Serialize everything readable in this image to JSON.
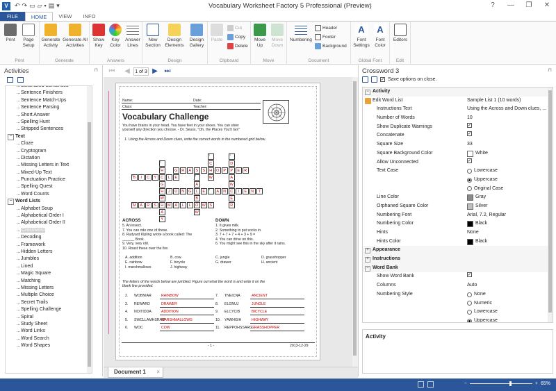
{
  "app": {
    "title": "Vocabulary Worksheet Factory 5 Professional (Preview)",
    "icon": "V",
    "window_controls": [
      "?",
      "—",
      "❐",
      "✕"
    ]
  },
  "tabs": [
    "FILE",
    "HOME",
    "VIEW",
    "INFO"
  ],
  "ribbon": {
    "groups": [
      {
        "label": "Print",
        "buttons": [
          "Print",
          "Page Setup"
        ]
      },
      {
        "label": "Generate",
        "buttons": [
          "Generate Activity",
          "Generate All Activities"
        ]
      },
      {
        "label": "Answers",
        "buttons": [
          "Show Key",
          "Key Color",
          "Answer Lines"
        ]
      },
      {
        "label": "Design",
        "buttons": [
          "New Section",
          "Design Elements",
          "Design Gallery"
        ]
      },
      {
        "label": "Clipboard",
        "buttons": [
          "Paste",
          "Cut",
          "Copy",
          "Delete"
        ]
      },
      {
        "label": "Move",
        "buttons": [
          "Move Up",
          "Move Down"
        ]
      },
      {
        "label": "Document",
        "buttons": [
          "Numbering",
          "Header",
          "Footer",
          "Background"
        ]
      },
      {
        "label": "Global Font",
        "buttons": [
          "Font Settings",
          "Font Color"
        ]
      },
      {
        "label": "Edit",
        "buttons": [
          "Editors"
        ]
      }
    ]
  },
  "activities": {
    "title": "Activities",
    "items": [
      {
        "kind": "item",
        "label": "Scrambled Sentences"
      },
      {
        "kind": "item",
        "label": "Sentence Finishers"
      },
      {
        "kind": "item",
        "label": "Sentence Match-Ups"
      },
      {
        "kind": "item",
        "label": "Sentence Parsing"
      },
      {
        "kind": "item",
        "label": "Short Answer"
      },
      {
        "kind": "item",
        "label": "Spelling Hunt"
      },
      {
        "kind": "item",
        "label": "Stripped Sentences"
      },
      {
        "kind": "cat",
        "label": "Text"
      },
      {
        "kind": "item",
        "label": "Cloze"
      },
      {
        "kind": "item",
        "label": "Cryptogram"
      },
      {
        "kind": "item",
        "label": "Dictation"
      },
      {
        "kind": "item",
        "label": "Missing Letters in Text"
      },
      {
        "kind": "item",
        "label": "Mixed-Up Text"
      },
      {
        "kind": "item",
        "label": "Punctuation Practice"
      },
      {
        "kind": "item",
        "label": "Spelling Quest"
      },
      {
        "kind": "item",
        "label": "Word Counts"
      },
      {
        "kind": "cat",
        "label": "Word Lists"
      },
      {
        "kind": "item",
        "label": "Alphabet Soup"
      },
      {
        "kind": "item",
        "label": "Alphabetical Order I"
      },
      {
        "kind": "item",
        "label": "Alphabetical Order II"
      },
      {
        "kind": "item",
        "label": "Crossword",
        "selected": true
      },
      {
        "kind": "item",
        "label": "Decoding"
      },
      {
        "kind": "item",
        "label": "Framework"
      },
      {
        "kind": "item",
        "label": "Hidden Letters"
      },
      {
        "kind": "item",
        "label": "Jumbles"
      },
      {
        "kind": "item",
        "label": "Lined"
      },
      {
        "kind": "item",
        "label": "Magic Square"
      },
      {
        "kind": "item",
        "label": "Matching"
      },
      {
        "kind": "item",
        "label": "Missing Letters"
      },
      {
        "kind": "item",
        "label": "Multiple Choice"
      },
      {
        "kind": "item",
        "label": "Secret Trails"
      },
      {
        "kind": "item",
        "label": "Spelling Challenge"
      },
      {
        "kind": "item",
        "label": "Spiral"
      },
      {
        "kind": "item",
        "label": "Study Sheet"
      },
      {
        "kind": "item",
        "label": "Word Links"
      },
      {
        "kind": "item",
        "label": "Word Search"
      },
      {
        "kind": "item",
        "label": "Word Shapes"
      }
    ]
  },
  "nav": {
    "page_indicator": "1 of 3"
  },
  "document_tab": "Document 1",
  "worksheet": {
    "name_label": "Name:",
    "date_label": "Date:",
    "class_label": "Class:",
    "teacher_label": "Teacher:",
    "title": "Vocabulary Challenge",
    "intro1": "You have brains in your head. You have feet in your shoes. You can steer",
    "intro2": "yourself any direction you choose. - Dr. Seuss, \"Oh, the Places You'll Go!\"",
    "instruction1": "1.   Using the Across and Down clues, write the correct words in the numbered grid below.",
    "across_title": "ACROSS",
    "across": [
      "5.  An insect.",
      "7.  You can ride one of these.",
      "8.  Rudyard Kipling wrote a book called: The",
      "     ______ Book.",
      "9.  Very, very old.",
      "10. Roast these over the fire."
    ],
    "down_title": "DOWN",
    "down": [
      "1.  It gives milk.",
      "2.  Something to put socks in.",
      "3.  7 + 7 + 7 + 4 + 3 + 9 =",
      "4.  You can drive on this.",
      "6.  You might see this in the sky after it rains."
    ],
    "choices": [
      [
        "A.  addition",
        "B.  cow",
        "C.  jungle",
        "D.  grasshopper"
      ],
      [
        "E.  rainbow",
        "F.  bicycle",
        "G.  drawer",
        "H.  ancient"
      ],
      [
        "I.   marshmallows",
        "J.  highway",
        "",
        ""
      ]
    ],
    "instruction2a": "The letters of the words below are jumbled. Figure out what the word is and write it on the",
    "instruction2b": "blank line provided.",
    "jumbles_left": [
      {
        "num": "2.",
        "jumble": "WOBNIAR",
        "answer": "RAINBOW"
      },
      {
        "num": "3.",
        "jumble": "REWARD",
        "answer": "DRAWER"
      },
      {
        "num": "4.",
        "jumble": "NOITIDDA",
        "answer": "ADDITION"
      },
      {
        "num": "5.",
        "jumble": "SWCLLAMHSRAM",
        "answer": "MARSHMALLOWS"
      },
      {
        "num": "6.",
        "jumble": "WOC",
        "answer": "COW"
      }
    ],
    "jumbles_right": [
      {
        "num": "7.",
        "jumble": "TNEICNA",
        "answer": "ANCIENT"
      },
      {
        "num": "8.",
        "jumble": "ELGNUJ",
        "answer": "JUNGLE"
      },
      {
        "num": "9.",
        "jumble": "ELCYCIB",
        "answer": "BICYCLE"
      },
      {
        "num": "10.",
        "jumble": "YAWHGIH",
        "answer": "HIGHWAY"
      },
      {
        "num": "11.",
        "jumble": "REPPOHSSARG",
        "answer": "GRASSHOPPER"
      }
    ],
    "footer_page": "- 1 -",
    "footer_date": "2013-12-29"
  },
  "crossword": {
    "cells": [
      [
        1,
        11,
        "",
        "1"
      ],
      [
        1,
        14,
        "",
        "2"
      ],
      [
        2,
        4,
        "",
        "3"
      ],
      [
        2,
        11,
        "C",
        ""
      ],
      [
        2,
        14,
        "D",
        ""
      ],
      [
        3,
        4,
        "H",
        "4"
      ],
      [
        3,
        6,
        "G",
        ""
      ],
      [
        3,
        7,
        "R",
        ""
      ],
      [
        3,
        8,
        "A",
        ""
      ],
      [
        3,
        9,
        "S",
        ""
      ],
      [
        3,
        10,
        "S",
        ""
      ],
      [
        3,
        11,
        "H",
        ""
      ],
      [
        3,
        12,
        "O",
        ""
      ],
      [
        3,
        13,
        "P",
        ""
      ],
      [
        3,
        14,
        "P",
        ""
      ],
      [
        3,
        15,
        "E",
        ""
      ],
      [
        3,
        16,
        "R",
        ""
      ],
      [
        4,
        0,
        "B",
        "5"
      ],
      [
        4,
        1,
        "I",
        ""
      ],
      [
        4,
        2,
        "C",
        ""
      ],
      [
        4,
        3,
        "Y",
        ""
      ],
      [
        4,
        4,
        "C",
        ""
      ],
      [
        4,
        5,
        "L",
        ""
      ],
      [
        4,
        6,
        "E",
        ""
      ],
      [
        4,
        9,
        "",
        "6"
      ],
      [
        4,
        11,
        "W",
        ""
      ],
      [
        4,
        14,
        "A",
        ""
      ],
      [
        5,
        4,
        "G",
        ""
      ],
      [
        5,
        9,
        "A",
        ""
      ],
      [
        5,
        14,
        "W",
        ""
      ],
      [
        6,
        4,
        "H",
        "7"
      ],
      [
        6,
        5,
        "J",
        ""
      ],
      [
        6,
        6,
        "U",
        ""
      ],
      [
        6,
        7,
        "N",
        ""
      ],
      [
        6,
        8,
        "G",
        ""
      ],
      [
        6,
        9,
        "L",
        ""
      ],
      [
        6,
        10,
        "E",
        ""
      ],
      [
        6,
        11,
        "",
        "8"
      ],
      [
        6,
        12,
        "A",
        ""
      ],
      [
        6,
        13,
        "N",
        ""
      ],
      [
        6,
        14,
        "C",
        ""
      ],
      [
        6,
        15,
        "I",
        ""
      ],
      [
        6,
        16,
        "E",
        ""
      ],
      [
        6,
        17,
        "N",
        ""
      ],
      [
        6,
        18,
        "T",
        ""
      ],
      [
        7,
        4,
        "W",
        ""
      ],
      [
        7,
        9,
        "B",
        ""
      ],
      [
        7,
        14,
        "E",
        ""
      ],
      [
        8,
        0,
        "M",
        "9"
      ],
      [
        8,
        1,
        "A",
        ""
      ],
      [
        8,
        2,
        "R",
        ""
      ],
      [
        8,
        3,
        "S",
        ""
      ],
      [
        8,
        4,
        "H",
        ""
      ],
      [
        8,
        5,
        "M",
        ""
      ],
      [
        8,
        6,
        "A",
        ""
      ],
      [
        8,
        7,
        "L",
        ""
      ],
      [
        8,
        8,
        "L",
        ""
      ],
      [
        8,
        9,
        "O",
        ""
      ],
      [
        8,
        10,
        "W",
        ""
      ],
      [
        8,
        11,
        "S",
        ""
      ],
      [
        8,
        14,
        "R",
        ""
      ],
      [
        9,
        4,
        "A",
        ""
      ],
      [
        9,
        9,
        "W",
        ""
      ],
      [
        10,
        4,
        "Y",
        ""
      ]
    ]
  },
  "properties": {
    "title": "Crossword 3",
    "save_option": "Save options on close.",
    "rows": [
      {
        "type": "cat",
        "label": "Activity"
      },
      {
        "type": "prop",
        "name": "Edit Word List",
        "value": "Sample List 1 (10 words)",
        "icon": "edit-icon"
      },
      {
        "type": "prop",
        "name": "Instructions Text",
        "value": "Using the Across and Down clues, ..."
      },
      {
        "type": "prop",
        "name": "Number of Words",
        "value": "10"
      },
      {
        "type": "check",
        "name": "Show Duplicate Warnings",
        "checked": true
      },
      {
        "type": "check",
        "name": "Concatenate",
        "checked": true
      },
      {
        "type": "prop",
        "name": "Square Size",
        "value": "33"
      },
      {
        "type": "color",
        "name": "Square Background Color",
        "value": "White",
        "color": "#ffffff"
      },
      {
        "type": "check",
        "name": "Allow Unconnected",
        "checked": true
      },
      {
        "type": "radio",
        "name": "Text Case",
        "value": "Lowercase",
        "on": false
      },
      {
        "type": "radio",
        "name": "",
        "value": "Uppercase",
        "on": true
      },
      {
        "type": "radio",
        "name": "",
        "value": "Original Case",
        "on": false
      },
      {
        "type": "color",
        "name": "Line Color",
        "value": "Gray",
        "color": "#8a8a8a"
      },
      {
        "type": "color",
        "name": "Orphaned Square Color",
        "value": "Silver",
        "color": "#c0c0c0"
      },
      {
        "type": "prop",
        "name": "Numbering Font",
        "value": "Arial, 7.2, Regular"
      },
      {
        "type": "color",
        "name": "Numbering Color",
        "value": "Black",
        "color": "#000000"
      },
      {
        "type": "prop",
        "name": "Hints",
        "value": "None"
      },
      {
        "type": "color",
        "name": "Hints Color",
        "value": "Black",
        "color": "#000000"
      },
      {
        "type": "catc",
        "label": "Appearance"
      },
      {
        "type": "catc",
        "label": "Instructions"
      },
      {
        "type": "cat",
        "label": "Word Bank"
      },
      {
        "type": "check",
        "name": "Show Word Bank",
        "checked": true
      },
      {
        "type": "prop",
        "name": "Columns",
        "value": "Auto"
      },
      {
        "type": "radio",
        "name": "Numbering Style",
        "value": "None",
        "on": false
      },
      {
        "type": "radio",
        "name": "",
        "value": "Numeric",
        "on": false
      },
      {
        "type": "radio",
        "name": "",
        "value": "Lowercase",
        "on": false
      },
      {
        "type": "radio",
        "name": "",
        "value": "Uppercase",
        "on": true
      }
    ],
    "description_title": "Activity"
  },
  "status": {
    "zoom": "65%",
    "zoom_minus": "−",
    "zoom_plus": "+",
    "zoom_fraction": 0.65
  },
  "colors": {
    "accent": "#2b579a",
    "answer": "#cc0000"
  }
}
